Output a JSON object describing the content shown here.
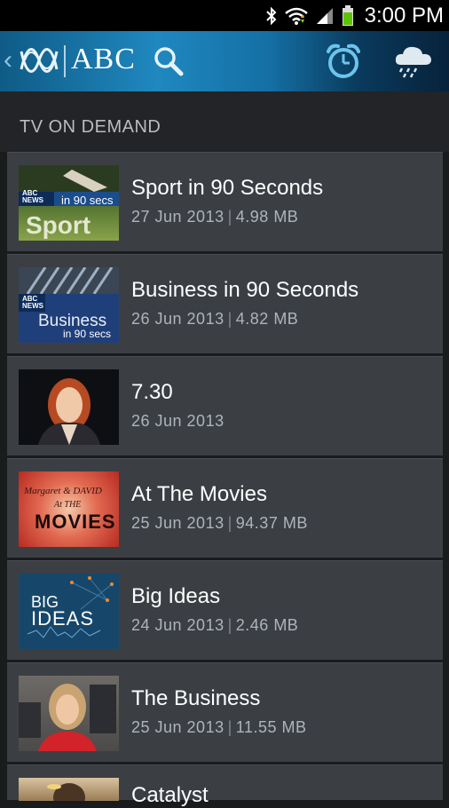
{
  "status_bar": {
    "time": "3:00 PM",
    "icons": [
      "bluetooth-icon",
      "wifi-icon",
      "signal-icon",
      "battery-icon"
    ]
  },
  "action_bar": {
    "title": "ABC",
    "icons": [
      "back-chevron-icon",
      "abc-logo-icon",
      "search-icon",
      "alarm-clock-icon",
      "weather-cloud-icon"
    ],
    "back_glyph": "‹",
    "colors": {
      "bar": "#1f88bf",
      "icon_accent": "#6cc4ee"
    }
  },
  "section": {
    "title": "TV ON DEMAND"
  },
  "items": [
    {
      "title": "Sport in 90 Seconds",
      "date": "27 Jun 2013",
      "size": "4.98 MB",
      "thumb": {
        "badge": "ABC NEWS",
        "line1": "in 90 secs",
        "line2": "Sport"
      }
    },
    {
      "title": "Business in 90 Seconds",
      "date": "26 Jun 2013",
      "size": "4.82 MB",
      "thumb": {
        "badge": "ABC NEWS",
        "line1": "Business",
        "line2": "in 90 secs"
      }
    },
    {
      "title": "7.30",
      "date": "26 Jun 2013",
      "size": ""
    },
    {
      "title": "At The Movies",
      "date": "25 Jun 2013",
      "size": "94.37 MB",
      "thumb": {
        "line1": "Margaret & DAVID",
        "line2": "At THE",
        "line3": "MOVIES"
      }
    },
    {
      "title": "Big Ideas",
      "date": "24 Jun 2013",
      "size": "2.46 MB",
      "thumb": {
        "line1": "BIG",
        "line2": "IDEAS"
      }
    },
    {
      "title": "The Business",
      "date": "25 Jun 2013",
      "size": "11.55 MB"
    },
    {
      "title": "Catalyst",
      "date": "",
      "size": ""
    }
  ],
  "separator": "|"
}
